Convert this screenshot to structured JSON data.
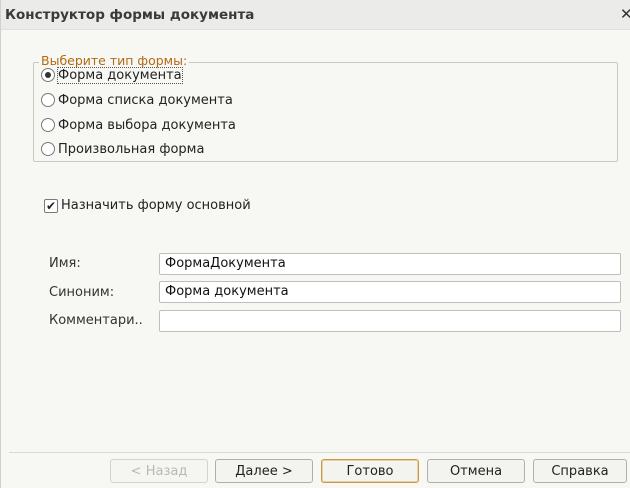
{
  "window": {
    "title": "Конструктор формы документа",
    "close_icon": "✕"
  },
  "form_type": {
    "legend": "Выберите тип формы:",
    "options": [
      {
        "label": "Форма документа",
        "selected": true
      },
      {
        "label": "Форма списка документа",
        "selected": false
      },
      {
        "label": "Форма выбора документа",
        "selected": false
      },
      {
        "label": "Произвольная форма",
        "selected": false
      }
    ]
  },
  "main_form_checkbox": {
    "label": "Назначить форму основной",
    "checked": true,
    "mark": "✔"
  },
  "fields": {
    "name": {
      "label": "Имя:",
      "value": "ФормаДокумента"
    },
    "synonym": {
      "label": "Синоним:",
      "value": "Форма документа"
    },
    "comment": {
      "label": "Комментари..",
      "value": ""
    }
  },
  "buttons": {
    "back": "< Назад",
    "next": "Далее >",
    "finish": "Готово",
    "cancel": "Отмена",
    "help": "Справка"
  },
  "colors": {
    "legend": "#b36a14",
    "default_button_border": "#c49a4a"
  },
  "icons": {
    "close": "close-icon",
    "radio": "radio-icon",
    "check": "checkmark-icon"
  }
}
